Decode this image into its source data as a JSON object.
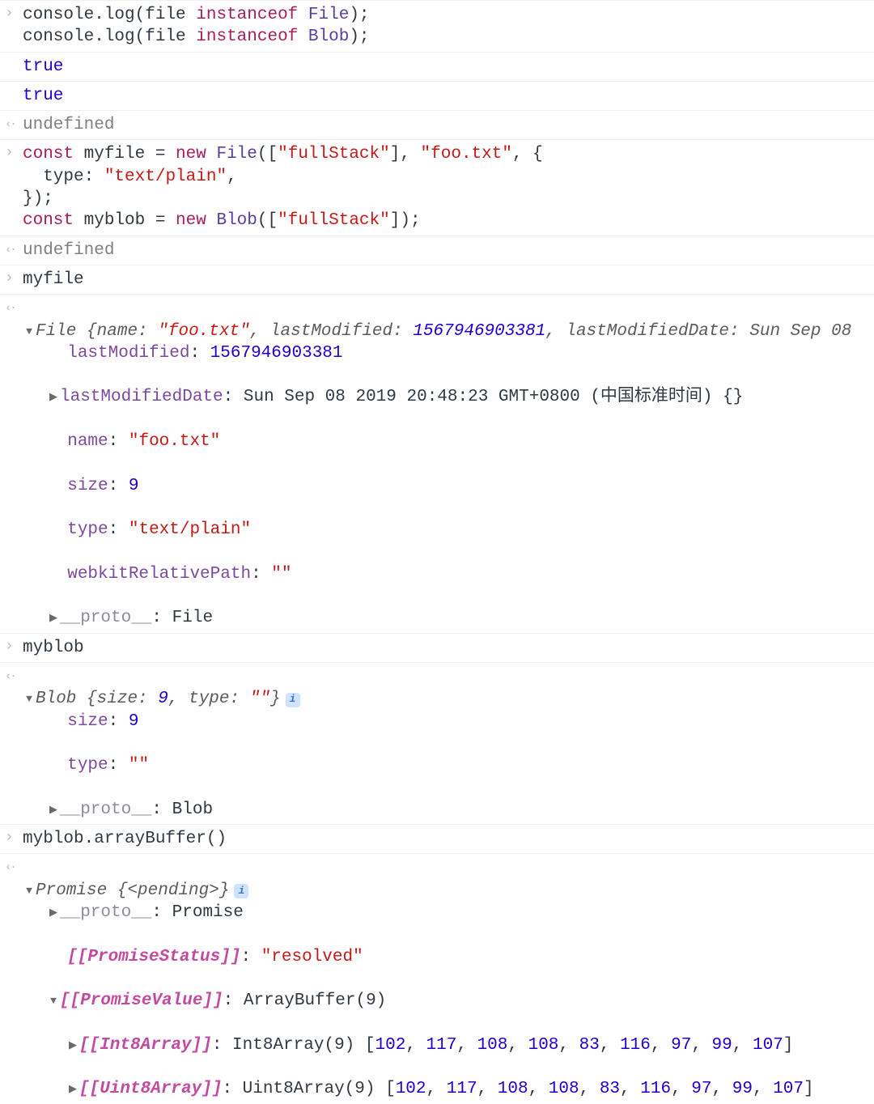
{
  "rows": {
    "r1_code": "console.log(file instanceof File);\nconsole.log(file instanceof Blob);",
    "r2_true": "true",
    "r3_true": "true",
    "r4_undef": "undefined",
    "r5_code": "const myfile = new File([\"fullStack\"], \"foo.txt\", {\n  type: \"text/plain\",\n});\nconst myblob = new Blob([\"fullStack\"]);",
    "r6_undef": "undefined",
    "r7_in": "myfile",
    "file_summary_class": "File",
    "file_summary_name_k": "name:",
    "file_summary_name_v": "\"foo.txt\"",
    "file_summary_lm_k": "lastModified:",
    "file_summary_lm_v": "1567946903381",
    "file_summary_lmd_k": "lastModifiedDate:",
    "file_summary_lmd_v": "Sun Sep 08",
    "file_lm_k": "lastModified",
    "file_lm_v": "1567946903381",
    "file_lmd_k": "lastModifiedDate",
    "file_lmd_v": "Sun Sep 08 2019 20:48:23 GMT+0800 (中国标准时间)",
    "file_lmd_suffix": "{}",
    "file_name_k": "name",
    "file_name_v": "\"foo.txt\"",
    "file_size_k": "size",
    "file_size_v": "9",
    "file_type_k": "type",
    "file_type_v": "\"text/plain\"",
    "file_wrp_k": "webkitRelativePath",
    "file_wrp_v": "\"\"",
    "file_proto_k": "__proto__",
    "file_proto_v": "File",
    "r9_in": "myblob",
    "blob_summary_class": "Blob",
    "blob_summary_size_k": "size:",
    "blob_summary_size_v": "9",
    "blob_summary_type_k": "type:",
    "blob_summary_type_v": "\"\"",
    "blob_size_k": "size",
    "blob_size_v": "9",
    "blob_type_k": "type",
    "blob_type_v": "\"\"",
    "blob_proto_k": "__proto__",
    "blob_proto_v": "Blob",
    "r11_in": "myblob.arrayBuffer()",
    "prom_summary_class": "Promise",
    "prom_summary_state": "<pending>",
    "prom_proto_k": "__proto__",
    "prom_proto_v": "Promise",
    "prom_status_k": "[[PromiseStatus]]",
    "prom_status_v": "\"resolved\"",
    "prom_value_k": "[[PromiseValue]]",
    "prom_value_v": "ArrayBuffer(9)",
    "int8_k": "[[Int8Array]]",
    "int8_prefix": "Int8Array(9)",
    "int8_vals": "[102, 117, 108, 108, 83, 116, 97, 99, 107]",
    "uint8_k": "[[Uint8Array]]",
    "uint8_prefix": "Uint8Array(9)",
    "uint8_vals": "[102, 117, 108, 108, 83, 116, 97, 99, 107]"
  }
}
